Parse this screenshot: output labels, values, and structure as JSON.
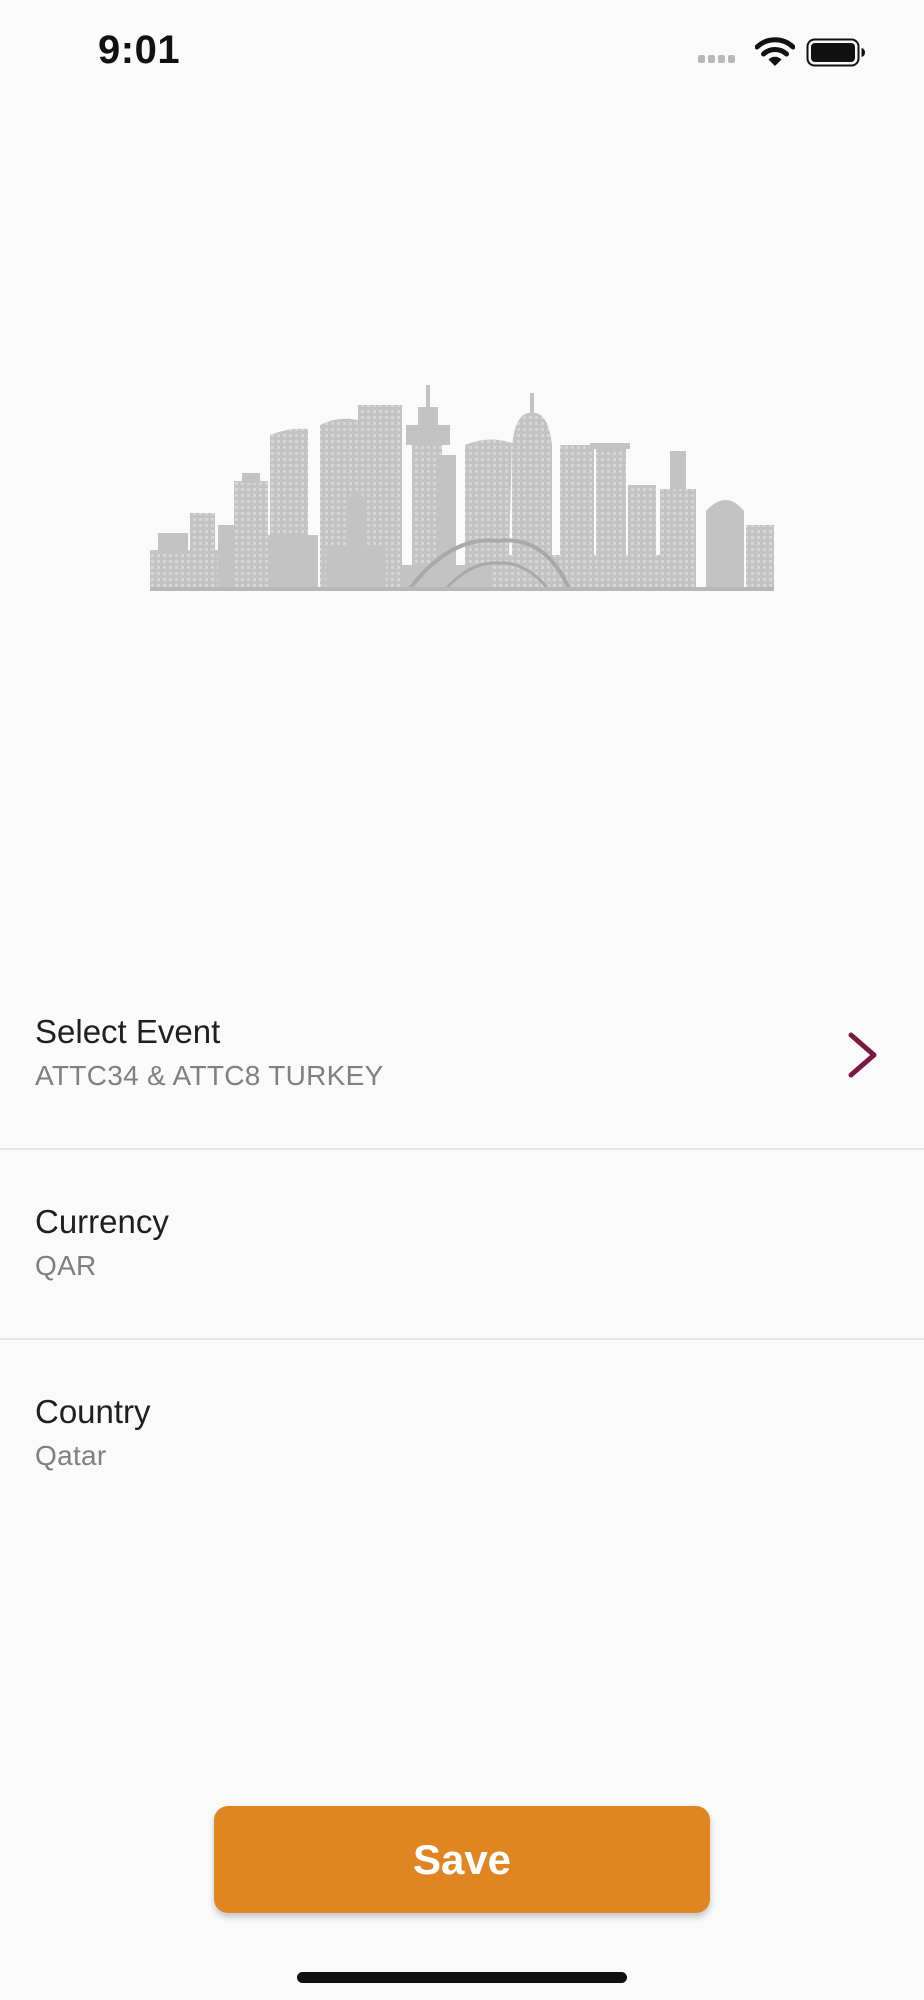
{
  "status_bar": {
    "time": "9:01",
    "icons": [
      "signal-icon",
      "wifi-icon",
      "battery-icon"
    ]
  },
  "hero": {
    "illustration": "doha-skyline-illustration",
    "color": "#c3c3c3"
  },
  "settings": {
    "event": {
      "label": "Select Event",
      "value": "ATTC34 & ATTC8 TURKEY",
      "icon": "chevron-right-icon"
    },
    "currency": {
      "label": "Currency",
      "value": "QAR"
    },
    "country": {
      "label": "Country",
      "value": "Qatar"
    }
  },
  "actions": {
    "save_label": "Save"
  },
  "colors": {
    "accent": "#df8522",
    "chevron": "#7a1846",
    "background": "#fafafa",
    "divider": "#e4e4e4",
    "secondary_text": "#808080"
  }
}
